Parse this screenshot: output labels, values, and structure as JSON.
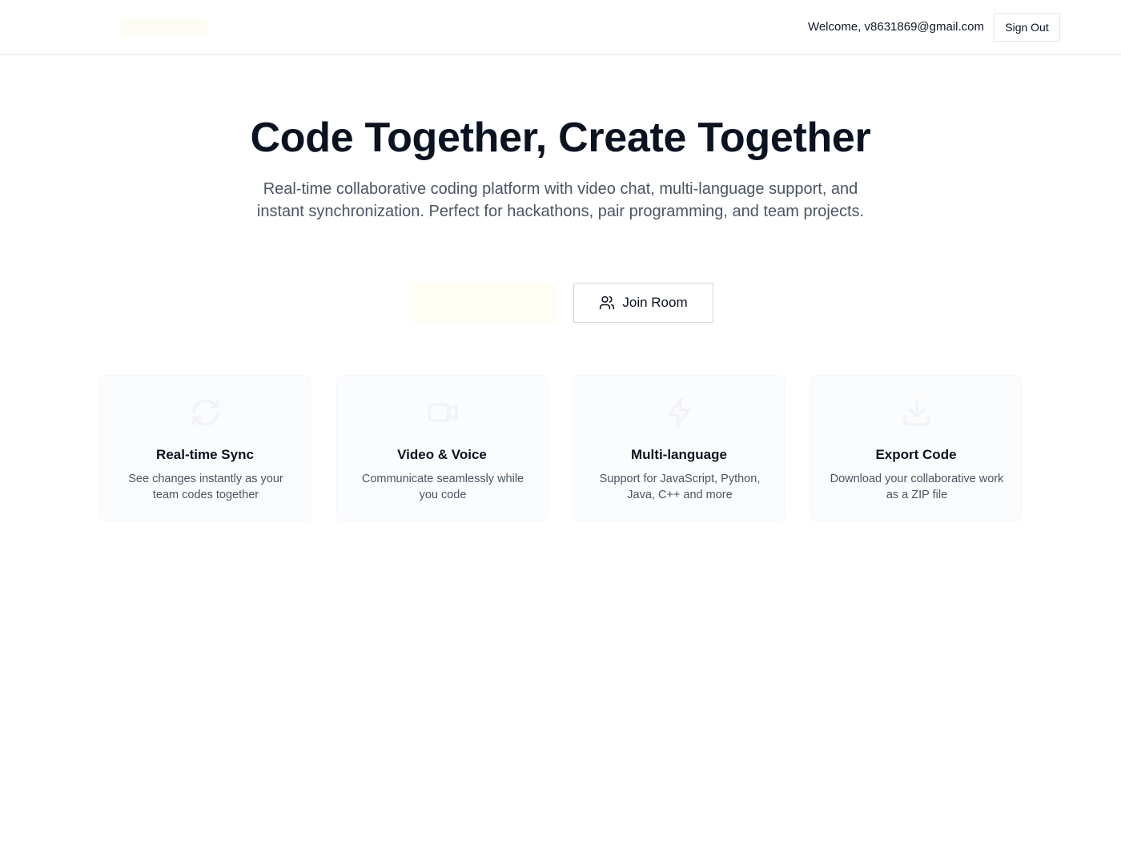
{
  "header": {
    "welcome_text": "Welcome, v8631869@gmail.com",
    "sign_out_label": "Sign Out"
  },
  "hero": {
    "title": "Code Together, Create Together",
    "subtitle": "Real-time collaborative coding platform with video chat, multi-language support, and instant synchronization. Perfect for hackathons, pair programming, and team projects."
  },
  "actions": {
    "join_room_label": "Join Room",
    "join_room_icon": "users-icon"
  },
  "features": [
    {
      "icon": "sync-icon",
      "title": "Real-time Sync",
      "description": "See changes instantly as your team codes together"
    },
    {
      "icon": "video-icon",
      "title": "Video & Voice",
      "description": "Communicate seamlessly while you code"
    },
    {
      "icon": "zap-icon",
      "title": "Multi-language",
      "description": "Support for JavaScript, Python, Java, C++ and more"
    },
    {
      "icon": "download-icon",
      "title": "Export Code",
      "description": "Download your collaborative work as a ZIP file"
    }
  ],
  "colors": {
    "text_primary": "#0b1220",
    "text_secondary": "#4b5563",
    "border": "#e5e7eb",
    "card_bg": "#fbfcfd"
  }
}
